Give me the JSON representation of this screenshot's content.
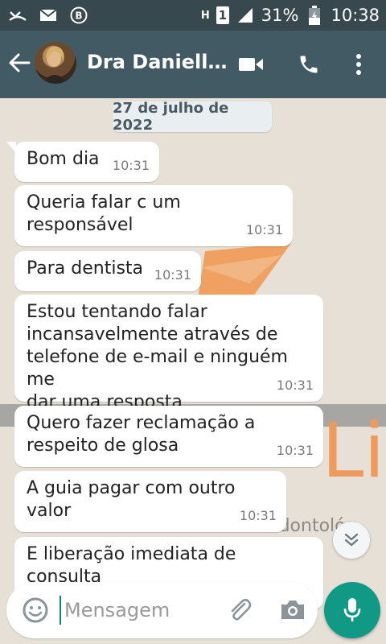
{
  "status_bar": {
    "network_label": "H",
    "sim_slot": "1",
    "battery_percent": "31%",
    "time": "10:38",
    "icons": [
      "missed-call-icon",
      "mail-icon",
      "b-app-icon",
      "data-h-icon",
      "sim-1-icon",
      "signal-icon",
      "battery-charging-icon"
    ]
  },
  "header": {
    "contact_name": "Dra Danielle…",
    "icons": [
      "back-arrow-icon",
      "video-call-icon",
      "phone-icon",
      "more-vert-icon"
    ]
  },
  "chat": {
    "date_chip": "27 de julho de 2022",
    "messages": [
      {
        "text": "Bom dia",
        "time": "10:31"
      },
      {
        "text": "Queria falar c um responsável",
        "time": "10:31"
      },
      {
        "text": "Para dentista",
        "time": "10:31"
      },
      {
        "text": "Estou tentando falar\nincansavelmente através de\ntelefone de e-mail e ninguém me\ndar uma resposta",
        "time": "10:31"
      },
      {
        "text": "Quero fazer reclamação a\nrespeito de glosa",
        "time": "10:31"
      },
      {
        "text": "A guia pagar com outro valor",
        "time": "10:31"
      },
      {
        "text": "E liberação imediata de consulta\npois não vou ficar atendendo",
        "time": ""
      }
    ],
    "watermark_text_1": "Life",
    "watermark_text_2": "Plano Odontológ"
  },
  "composer": {
    "placeholder": "Mensagem",
    "value": ""
  },
  "colors": {
    "header_bg": "#425a64",
    "status_bg": "#38484f",
    "accent": "#109a86",
    "bubble_bg": "#ffffff",
    "chat_bg": "#e6e0d7"
  }
}
